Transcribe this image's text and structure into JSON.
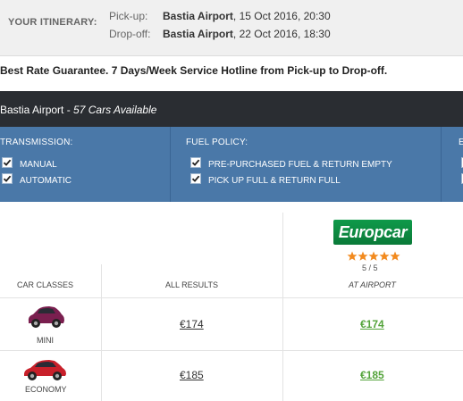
{
  "itinerary": {
    "label": "YOUR ITINERARY:",
    "pickup": {
      "key": "Pick-up:",
      "location": "Bastia Airport",
      "date": ", 15 Oct 2016, 20:30"
    },
    "dropoff": {
      "key": "Drop-off:",
      "location": "Bastia Airport",
      "date": ", 22 Oct 2016, 18:30"
    }
  },
  "guarantee": "Best Rate Guarantee. 7 Days/Week Service Hotline from Pick-up to Drop-off.",
  "location_bar": {
    "location": "Bastia Airport",
    "separator": " - ",
    "count": "57 Cars Available"
  },
  "filters": {
    "transmission": {
      "title": "TRANSMISSION:",
      "options": [
        "MANUAL",
        "AUTOMATIC"
      ],
      "checked": [
        true,
        true
      ]
    },
    "fuel_policy": {
      "title": "FUEL POLICY:",
      "options": [
        "PRE-PURCHASED FUEL & RETURN EMPTY",
        "PICK UP FULL & RETURN FULL"
      ],
      "checked": [
        true,
        true
      ]
    },
    "third": {
      "title": "E",
      "checked": [
        false,
        false
      ]
    }
  },
  "supplier": {
    "name": "Europcar",
    "stars": 5,
    "rating": "5 / 5",
    "brand_color": "#0f9a4a"
  },
  "columns": {
    "classes": "CAR CLASSES",
    "all": "ALL RESULTS",
    "supplier": "AT AIRPORT"
  },
  "rows": [
    {
      "class": "MINI",
      "all_price": "€174",
      "supplier_price": "€174",
      "car_color": "#7a1f4f"
    },
    {
      "class": "ECONOMY",
      "all_price": "€185",
      "supplier_price": "€185",
      "car_color": "#c8202a"
    }
  ],
  "colors": {
    "header_dark": "#2a2d32",
    "filter_blue": "#4a78a8",
    "price_green": "#53a33a"
  }
}
